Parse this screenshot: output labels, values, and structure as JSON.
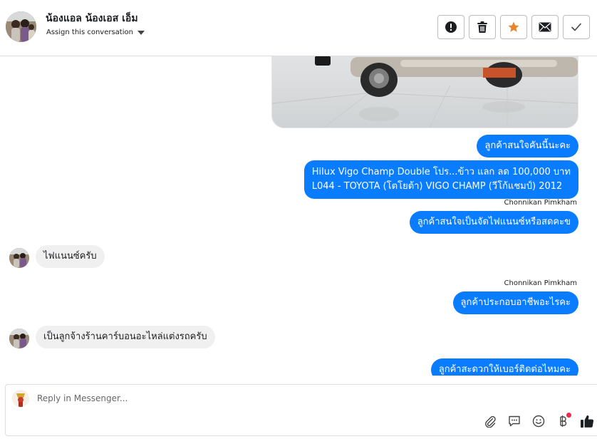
{
  "header": {
    "contact_name": "น้องแอล น้องเอส เอ็ม",
    "assign_label": "Assign this conversation",
    "actions": [
      {
        "name": "report-button",
        "icon": "exclamation-circle-icon"
      },
      {
        "name": "delete-button",
        "icon": "trash-icon"
      },
      {
        "name": "star-button",
        "icon": "star-icon",
        "color": "#e8842c"
      },
      {
        "name": "mark-unread-button",
        "icon": "envelope-icon"
      },
      {
        "name": "done-button",
        "icon": "checkmark-icon"
      }
    ]
  },
  "messages": [
    {
      "id": "m1",
      "direction": "out",
      "text": "ลูกค้าสนใจคันนี้นะคะ"
    },
    {
      "id": "m2",
      "direction": "out",
      "lines": [
        "Hilux Vigo Champ Double โปร...ข้าว แลก ลด 100,000 บาท",
        "L044 - TOYOTA (โตโยต้า) VIGO CHAMP (วีโก้แชมป์) 2012"
      ],
      "sender": "Chonnikan Pimkham"
    },
    {
      "id": "m3",
      "direction": "out",
      "text": "ลูกค้าสนใจเป็นจัดไฟแนนซ์หรือสดคะข"
    },
    {
      "id": "m4",
      "direction": "in",
      "text": "ไฟแนนซ์ครับ"
    },
    {
      "id": "m5",
      "direction": "out",
      "sender": "Chonnikan Pimkham",
      "text": "ลูกค้าประกอบอาชีพอะไรคะ"
    },
    {
      "id": "m6",
      "direction": "in",
      "text": "เป็นลูกจ้างร้านคาร์บอนอะไหล่แต่งรถครับ"
    },
    {
      "id": "m7",
      "direction": "out",
      "text": "ลูกค้าสะดวกให้เบอร์ติดต่อไหมคะ"
    }
  ],
  "composer": {
    "placeholder": "Reply in Messenger...",
    "tools": [
      "paperclip-icon",
      "saved-reply-icon",
      "emoji-icon",
      "baht-payment-icon",
      "thumbs-up-icon"
    ]
  },
  "colors": {
    "outgoing_bubble": "#0a7cff",
    "incoming_bubble": "#f0f0f0",
    "notification_dot": "#f02849"
  }
}
